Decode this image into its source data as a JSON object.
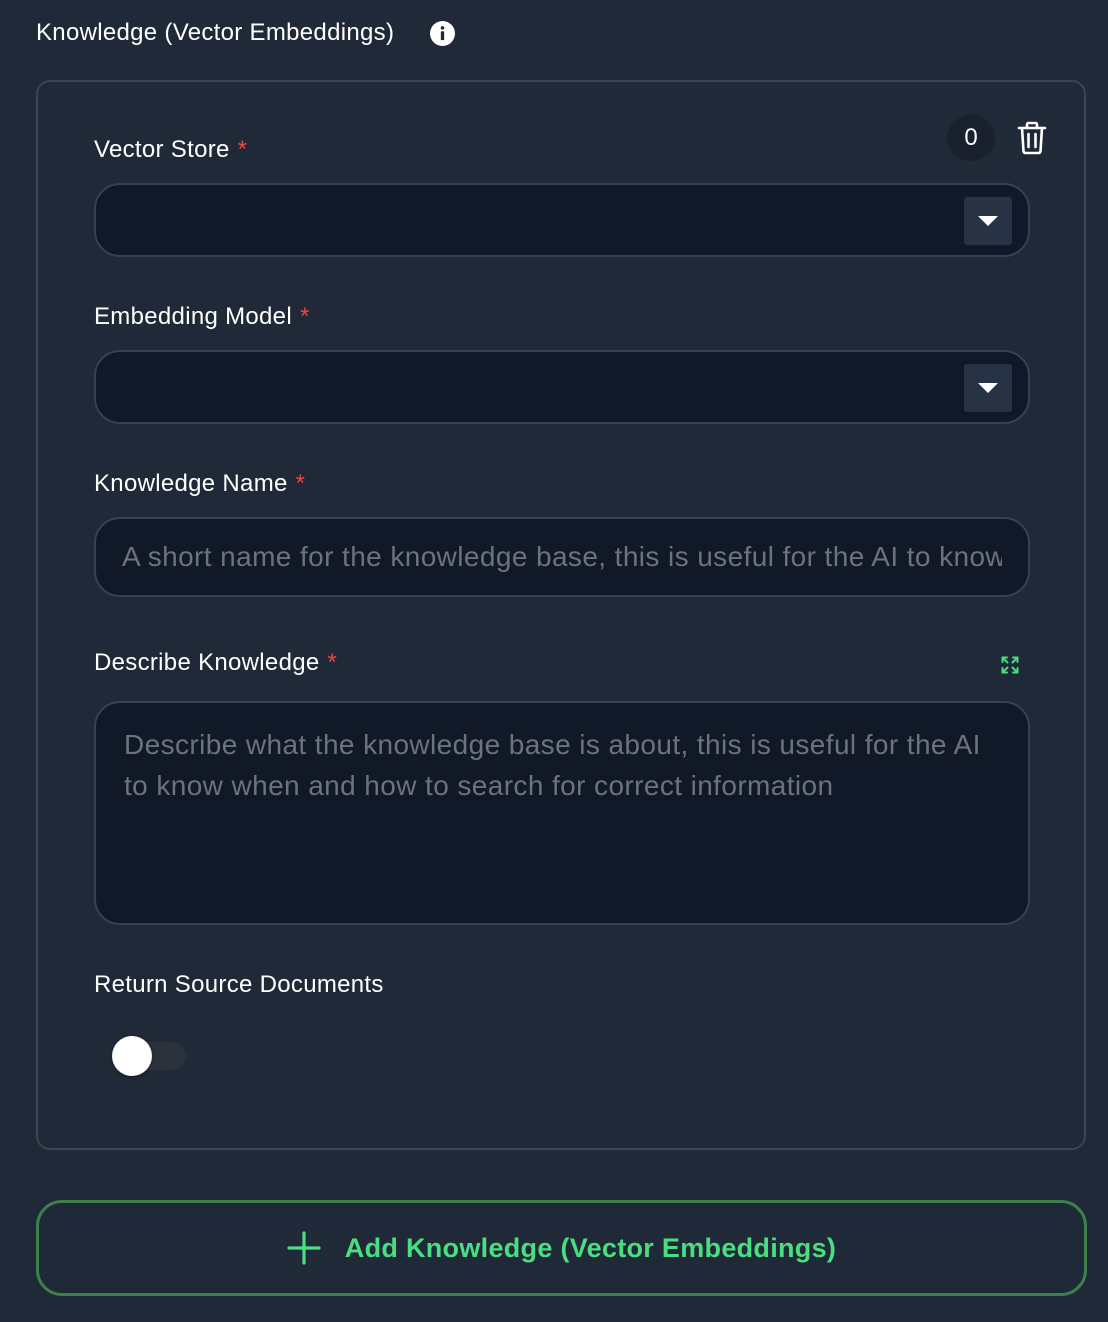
{
  "section": {
    "title": "Knowledge (Vector Embeddings)",
    "info_icon": "info-icon"
  },
  "card": {
    "index": "0",
    "delete_icon": "trash-icon",
    "required_marker": "*",
    "vector_store": {
      "label": "Vector Store",
      "value": ""
    },
    "embedding_model": {
      "label": "Embedding Model",
      "value": ""
    },
    "knowledge_name": {
      "label": "Knowledge Name",
      "value": "",
      "placeholder": "A short name for the knowledge base, this is useful for the AI to know when and how to search for correct information"
    },
    "describe_knowledge": {
      "label": "Describe Knowledge",
      "value": "",
      "placeholder": "Describe what the knowledge base is about, this is useful for the AI to know when and how to search for correct information",
      "expand_icon": "expand-icon"
    },
    "return_source_documents": {
      "label": "Return Source Documents",
      "enabled": false
    }
  },
  "add_button": {
    "label": "Add Knowledge (Vector Embeddings)",
    "icon": "plus-icon"
  },
  "colors": {
    "background": "#1f2937",
    "input_background": "#111827",
    "border": "#374151",
    "required": "#ef4444",
    "accent_green": "#4ade80",
    "button_border": "#3e8049"
  }
}
